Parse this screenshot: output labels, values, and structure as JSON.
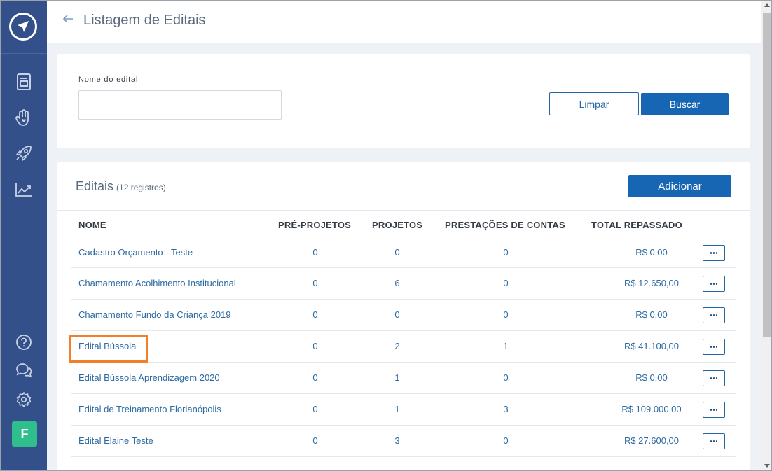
{
  "header": {
    "title": "Listagem de Editais"
  },
  "sidebar": {
    "nav": [
      {
        "icon": "document-icon"
      },
      {
        "icon": "hand-heart-icon"
      },
      {
        "icon": "rocket-icon"
      },
      {
        "icon": "chart-icon"
      }
    ],
    "bottom": [
      {
        "icon": "help-icon"
      },
      {
        "icon": "chat-icon"
      },
      {
        "icon": "gear-icon"
      }
    ],
    "avatar_letter": "F"
  },
  "filter": {
    "label": "Nome do edital",
    "value": "",
    "clear_label": "Limpar",
    "search_label": "Buscar"
  },
  "list": {
    "title": "Editais",
    "count": "(12 registros)",
    "add_label": "Adicionar",
    "columns": [
      "NOME",
      "PRÉ-PROJETOS",
      "PROJETOS",
      "PRESTAÇÕES DE CONTAS",
      "TOTAL REPASSADO"
    ],
    "rows": [
      {
        "name": "Cadastro Orçamento - Teste",
        "pre": "0",
        "proj": "0",
        "prest": "0",
        "total": "R$ 0,00"
      },
      {
        "name": "Chamamento Acolhimento Institucional",
        "pre": "0",
        "proj": "6",
        "prest": "0",
        "total": "R$ 12.650,00"
      },
      {
        "name": "Chamamento Fundo da Criança 2019",
        "pre": "0",
        "proj": "0",
        "prest": "0",
        "total": "R$ 0,00"
      },
      {
        "name": "Edital Bússola",
        "pre": "0",
        "proj": "2",
        "prest": "1",
        "total": "R$ 41.100,00"
      },
      {
        "name": "Edital Bússola Aprendizagem 2020",
        "pre": "0",
        "proj": "1",
        "prest": "0",
        "total": "R$ 0,00"
      },
      {
        "name": "Edital de Treinamento Florianópolis",
        "pre": "0",
        "proj": "1",
        "prest": "3",
        "total": "R$ 109.000,00"
      },
      {
        "name": "Edital Elaine Teste",
        "pre": "0",
        "proj": "3",
        "prest": "0",
        "total": "R$ 27.600,00"
      }
    ]
  },
  "colors": {
    "sidebar": "#34508a",
    "primary": "#1666b3",
    "link": "#2d6aa3",
    "highlight": "#f0802a",
    "avatar": "#2fbf8c"
  }
}
